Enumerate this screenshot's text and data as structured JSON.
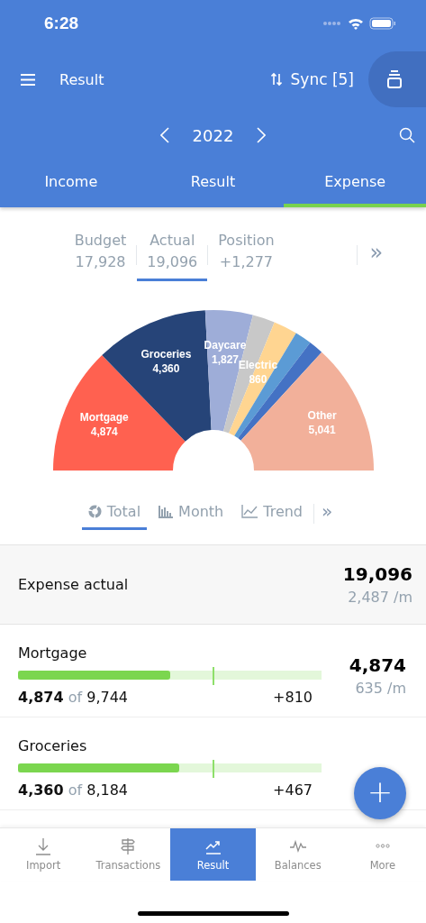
{
  "status_bar": {
    "time": "6:28"
  },
  "header": {
    "title": "Result",
    "sync": "Sync [5]"
  },
  "year": {
    "label": "2022"
  },
  "tabs": [
    {
      "label": "Income",
      "selected": false
    },
    {
      "label": "Result",
      "selected": false
    },
    {
      "label": "Expense",
      "selected": true
    }
  ],
  "summary_tabs": [
    {
      "label": "Budget",
      "value": "17,928",
      "selected": false
    },
    {
      "label": "Actual",
      "value": "19,096",
      "selected": true
    },
    {
      "label": "Position",
      "value": "+1,277",
      "selected": false
    }
  ],
  "summary_more": "»",
  "chart_data": {
    "type": "donut",
    "categories": [
      "Mortgage",
      "Groceries",
      "Daycare",
      "Electric",
      null,
      null,
      null,
      "Other"
    ],
    "values": [
      4874,
      4360,
      1827,
      860,
      920,
      645,
      569,
      5041
    ],
    "colors": [
      "#ff6150",
      "#264478",
      "#9eadd8",
      "#c8c8c8",
      "#ffd591",
      "#5b9bd5",
      "#4472c4",
      "#f2b09a"
    ],
    "value_labels": [
      "4,874",
      "4,360",
      "1,827",
      "860",
      null,
      null,
      null,
      "5,041"
    ]
  },
  "chart_tabs": [
    {
      "label": "Total",
      "kind": "donut",
      "selected": true
    },
    {
      "label": "Month",
      "kind": "bars",
      "selected": false
    },
    {
      "label": "Trend",
      "kind": "line",
      "selected": false
    }
  ],
  "chart_more": "»",
  "total": {
    "label": "Expense actual",
    "value": "19,096",
    "per_month": "2,487 /m"
  },
  "year_progress": {
    "level": 0.64
  },
  "rows": [
    {
      "name": "Mortgage",
      "level": 0.5,
      "actual": "4,874",
      "of": "of",
      "budget": "9,744",
      "diff": "+810",
      "value": "4,874",
      "per_month": "635 /m"
    },
    {
      "name": "Groceries",
      "level": 0.53,
      "actual": "4,360",
      "of": "of",
      "budget": "8,184",
      "diff": "+467"
    }
  ],
  "fab": {
    "label": "+"
  },
  "nav": [
    {
      "label": "Import",
      "kind": "import",
      "selected": false
    },
    {
      "label": "Transactions",
      "kind": "transactions",
      "selected": false
    },
    {
      "label": "Result",
      "kind": "result",
      "selected": true
    },
    {
      "label": "Balances",
      "kind": "balances",
      "selected": false
    },
    {
      "label": "More",
      "kind": "more",
      "selected": false
    }
  ]
}
